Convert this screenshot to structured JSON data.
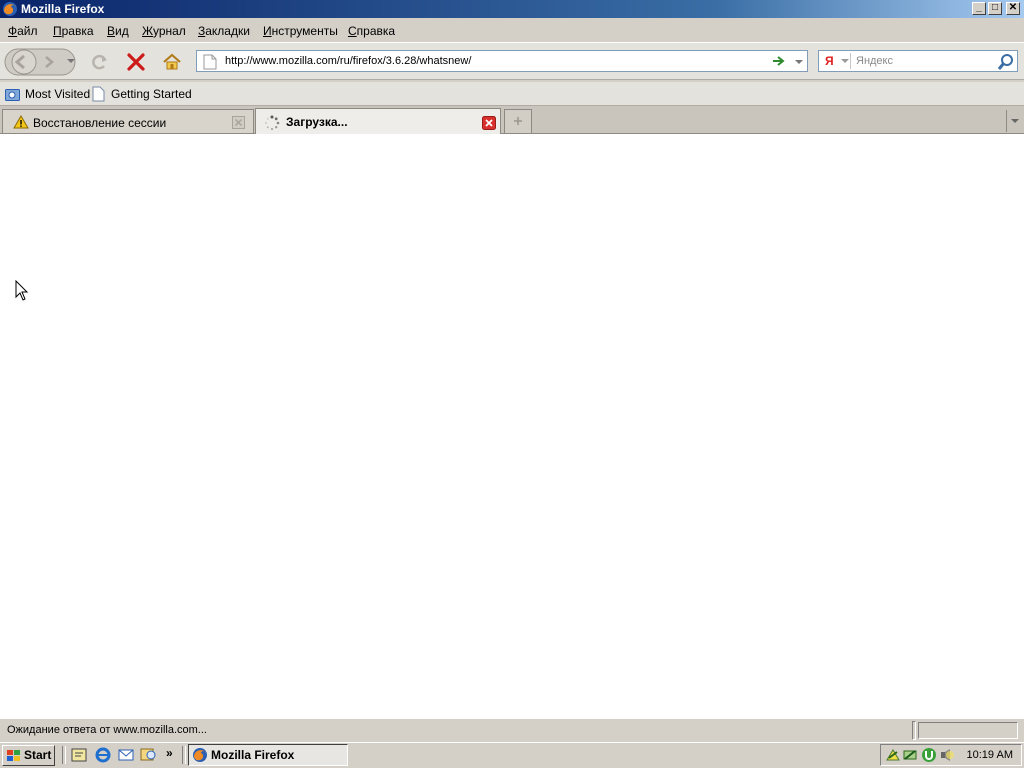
{
  "window": {
    "title": "Mozilla Firefox",
    "controls": {
      "minimize": "_",
      "maximize": "□",
      "close": "✕"
    }
  },
  "menu": [
    "Файл",
    "Правка",
    "Вид",
    "Журнал",
    "Закладки",
    "Инструменты",
    "Справка"
  ],
  "nav": {
    "url": "http://www.mozilla.com/ru/firefox/3.6.28/whatsnew/",
    "search_placeholder": "Яндекс",
    "search_engine_glyph": "Я"
  },
  "bookmarks": [
    "Most Visited",
    "Getting Started"
  ],
  "tabs": [
    {
      "label": "Восстановление сессии",
      "icon": "warning-icon"
    },
    {
      "label": "Загрузка...",
      "icon": "loading-spinner-icon"
    }
  ],
  "status": {
    "text": "Ожидание ответа от www.mozilla.com..."
  },
  "taskbar": {
    "start_label": "Start",
    "quicklaunch_more": "»",
    "window_button": "Mozilla Firefox",
    "clock": "10:19 AM"
  },
  "colors": {
    "titlebar_start": "#0a246a",
    "titlebar_end": "#a6caf0",
    "stop_red": "#cc1a1a",
    "go_green": "#2e8b2e",
    "tab_close_red": "#d8302c"
  }
}
